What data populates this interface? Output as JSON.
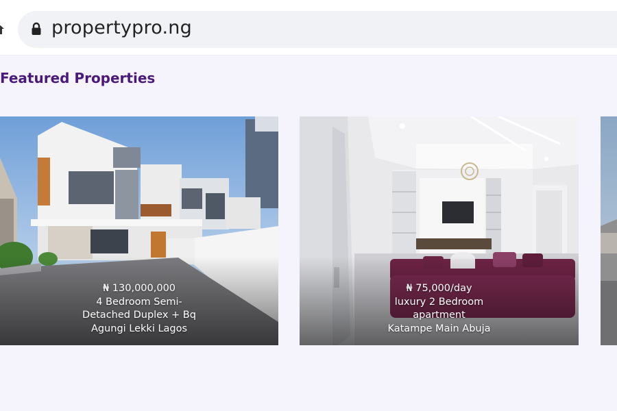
{
  "browser": {
    "url": "propertypro.ng",
    "home_icon": "home-icon",
    "lock_icon": "lock-icon"
  },
  "section": {
    "title": "Featured Properties",
    "title_color": "#4a1a7a"
  },
  "listings": [
    {
      "price": "₦ 130,000,000",
      "title_line1": "4 Bedroom Semi-",
      "title_line2": "Detached Duplex + Bq",
      "location": "Agungi Lekki Lagos"
    },
    {
      "price": "₦ 75,000/day",
      "title_line1": "luxury 2 Bedroom",
      "title_line2": "apartment",
      "location": "Katampe Main Abuja"
    }
  ]
}
